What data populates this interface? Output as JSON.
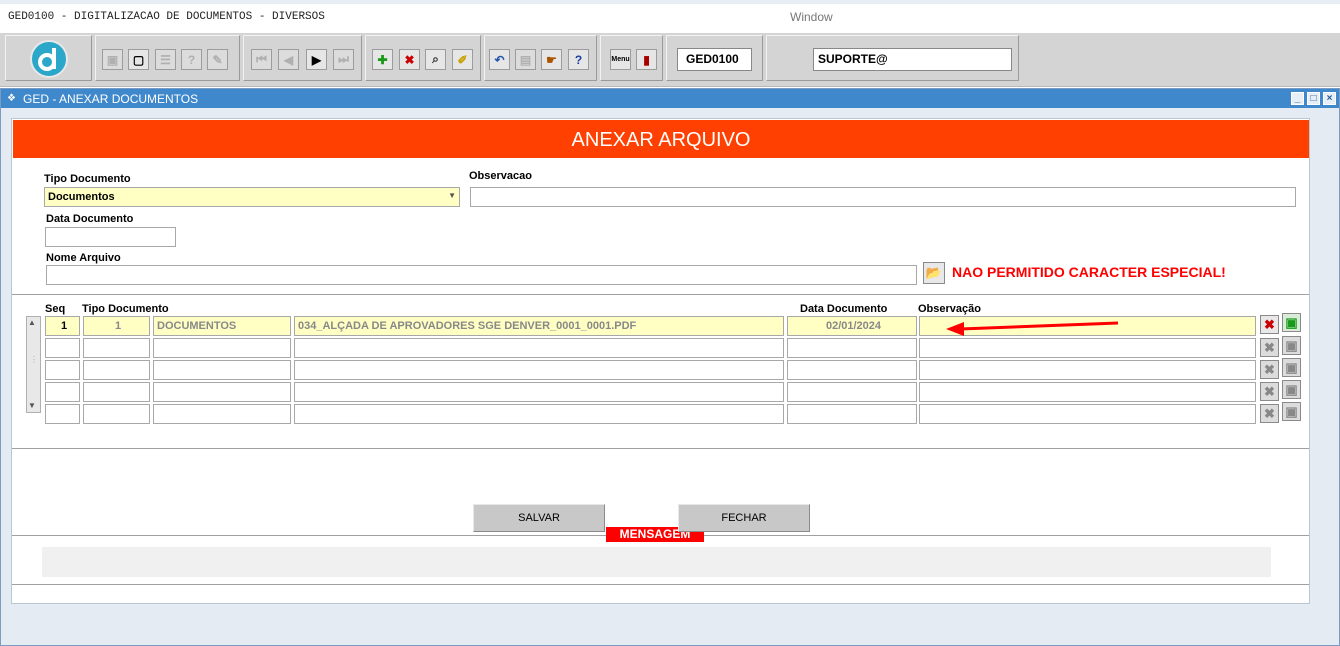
{
  "app": {
    "title": "GED0100 - DIGITALIZACAO DE DOCUMENTOS - DIVERSOS",
    "window_menu": "Window"
  },
  "toolbar": {
    "program_code": "GED0100",
    "user": "SUPORTE@",
    "icons": [
      "logo-d-icon",
      "save-icon",
      "window-icon",
      "print-icon",
      "help-query-icon",
      "edit-query-icon",
      "first-record-icon",
      "previous-record-icon",
      "next-record-icon",
      "last-record-icon",
      "insert-record-icon",
      "delete-record-icon",
      "query-record-icon",
      "clear-record-icon",
      "undo-icon",
      "clipboard-icon",
      "hand-icon",
      "help-icon",
      "menu-icon",
      "exit-door-icon"
    ],
    "menu_icon_text": "Menu"
  },
  "window": {
    "title": "GED - ANEXAR DOCUMENTOS"
  },
  "form": {
    "header": "ANEXAR ARQUIVO",
    "tipo_documento_label": "Tipo Documento",
    "tipo_documento_value": "Documentos",
    "observacao_label": "Observacao",
    "observacao_value": "",
    "data_documento_label": "Data Documento",
    "data_documento_value": "",
    "nome_arquivo_label": "Nome Arquivo",
    "nome_arquivo_value": "",
    "warning": "NAO PERMITIDO CARACTER ESPECIAL!"
  },
  "grid": {
    "headers": {
      "seq": "Seq",
      "tipo": "Tipo Documento",
      "data": "Data Documento",
      "obs": "Observação"
    },
    "rows": [
      {
        "seq": "1",
        "tipo_cod": "1",
        "tipo_desc": "DOCUMENTOS",
        "arquivo": "034_ALÇADA DE APROVADORES SGE DENVER_0001_0001.PDF",
        "data": "02/01/2024",
        "obs": ""
      },
      {
        "seq": "",
        "tipo_cod": "",
        "tipo_desc": "",
        "arquivo": "",
        "data": "",
        "obs": ""
      },
      {
        "seq": "",
        "tipo_cod": "",
        "tipo_desc": "",
        "arquivo": "",
        "data": "",
        "obs": ""
      },
      {
        "seq": "",
        "tipo_cod": "",
        "tipo_desc": "",
        "arquivo": "",
        "data": "",
        "obs": ""
      },
      {
        "seq": "",
        "tipo_cod": "",
        "tipo_desc": "",
        "arquivo": "",
        "data": "",
        "obs": ""
      }
    ]
  },
  "message": {
    "label": "MENSAGEM",
    "text": ""
  },
  "buttons": {
    "save": "SALVAR",
    "close": "FECHAR"
  },
  "colors": {
    "header": "#ff4000",
    "warning": "#ff0000",
    "row_highlight": "#ffffc4",
    "window_title": "#3f88cc"
  }
}
